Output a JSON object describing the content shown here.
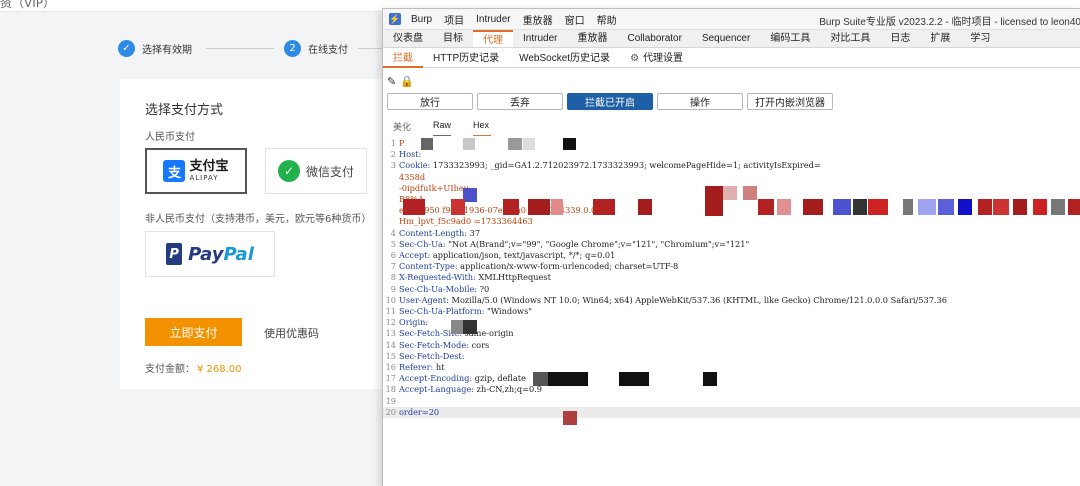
{
  "bg": {
    "top_text": "资（VIP）",
    "steps": [
      {
        "icon": "✓",
        "label": "选择有效期"
      },
      {
        "icon": "2",
        "label": "在线支付"
      }
    ],
    "card": {
      "title": "选择支付方式",
      "rmb_label": "人民币支付",
      "alipay_mark": "支",
      "alipay_cn": "支付宝",
      "alipay_en": "ALIPAY",
      "wechat_label": "微信支付",
      "nonrmb_label": "非人民币支付（支持港币，美元，欧元等6种货币）",
      "paypal_pay": "Pay",
      "paypal_pal": "Pal",
      "pay_button": "立即支付",
      "coupon": "使用优惠码",
      "amount_label": "支付金额：",
      "amount_value": "¥ 268.00"
    }
  },
  "burp": {
    "menu": [
      "Burp",
      "项目",
      "Intruder",
      "重放器",
      "窗口",
      "帮助"
    ],
    "window_title": "Burp Suite专业版  v2023.2.2 - 临时项目 - licensed to leon40",
    "tabs": [
      "仪表盘",
      "目标",
      "代理",
      "Intruder",
      "重放器",
      "Collaborator",
      "Sequencer",
      "编码工具",
      "对比工具",
      "日志",
      "扩展",
      "学习"
    ],
    "active_tab": "代理",
    "subtabs": [
      "拦截",
      "HTTP历史记录",
      "WebSocket历史记录",
      "代理设置"
    ],
    "active_subtab": "拦截",
    "buttons": [
      "放行",
      "丢弃",
      "拦截已开启",
      "操作",
      "打开内嵌浏览器"
    ],
    "view_tabs": [
      "美化",
      "Raw",
      "Hex"
    ],
    "request_lines": [
      {
        "n": "1",
        "t": "P"
      },
      {
        "n": "2",
        "t": "Host:"
      },
      {
        "n": "3",
        "t": "Cookie:                                   1733323993;  _gid=GA1.2.712023972.1733323993; welcomePageHide=1; activityIsExpired="
      },
      {
        "n": "",
        "t": "  4358d"
      },
      {
        "n": "",
        "t": "          -0ipdfuIk+UIheu"
      },
      {
        "n": "",
        "t": "                                                                                                                           B8%A"
      },
      {
        "n": "",
        "t": "  e1cbd950                                              f988-1936-07e5-2a0                                        1733364339.0.0.0"
      },
      {
        "n": "",
        "t": "  Hm_lpvt_f5c9ad0                           =1733364463"
      },
      {
        "n": "4",
        "t": "Content-Length: 37"
      },
      {
        "n": "5",
        "t": "Sec-Ch-Ua: \"Not A(Brand\";v=\"99\", \"Google Chrome\";v=\"121\", \"Chromium\";v=\"121\""
      },
      {
        "n": "6",
        "t": "Accept: application/json, text/javascript, */*; q=0.01"
      },
      {
        "n": "7",
        "t": "Content-Type: application/x-www-form-urlencoded; charset=UTF-8"
      },
      {
        "n": "8",
        "t": "X-Requested-With: XMLHttpRequest"
      },
      {
        "n": "9",
        "t": "Sec-Ch-Ua-Mobile: ?0"
      },
      {
        "n": "10",
        "t": "User-Agent: Mozilla/5.0 (Windows NT 10.0; Win64; x64) AppleWebKit/537.36 (KHTML, like Gecko) Chrome/121.0.0.0 Safari/537.36"
      },
      {
        "n": "11",
        "t": "Sec-Ch-Ua-Platform: \"Windows\""
      },
      {
        "n": "12",
        "t": "Origin:"
      },
      {
        "n": "13",
        "t": "Sec-Fetch-Site: same-origin"
      },
      {
        "n": "14",
        "t": "Sec-Fetch-Mode: cors"
      },
      {
        "n": "15",
        "t": "Sec-Fetch-Dest:"
      },
      {
        "n": "16",
        "t": "Referer: ht"
      },
      {
        "n": "17",
        "t": "Accept-Encoding: gzip, deflate"
      },
      {
        "n": "18",
        "t": "Accept-Language: zh-CN,zh;q=0.9"
      },
      {
        "n": "19",
        "t": ""
      },
      {
        "n": "20",
        "t": "order=20"
      }
    ]
  },
  "colors": {
    "accent": "#e26b2a",
    "intercept_on": "#1f5fa6",
    "pay_orange": "#f39200",
    "step_blue": "#2f89e6"
  },
  "icons": [
    "check-icon",
    "alipay-logo",
    "wechat-icon",
    "paypal-logo",
    "burp-logo-icon",
    "pencil-icon",
    "lock-icon",
    "gear-icon"
  ]
}
